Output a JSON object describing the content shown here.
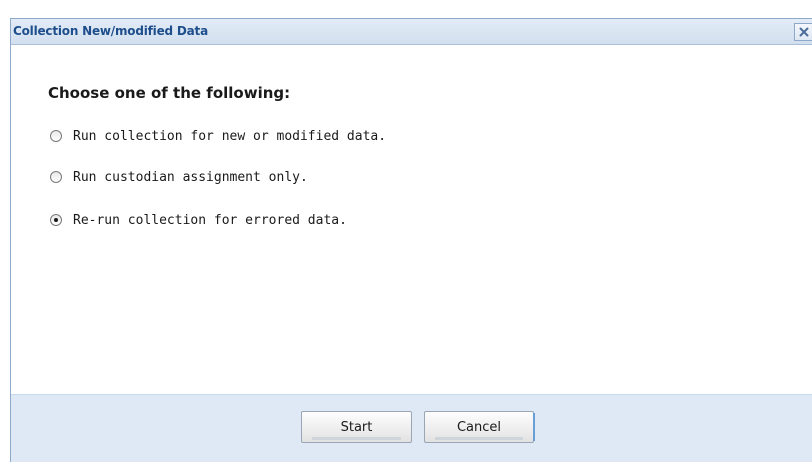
{
  "dialog": {
    "title": "Collection New/modified Data",
    "close_icon": "close-icon",
    "heading": "Choose one of the following:",
    "options": [
      {
        "label": "Run collection for new or modified data.",
        "selected": false
      },
      {
        "label": "Run custodian assignment only.",
        "selected": false
      },
      {
        "label": "Re-run collection for errored data.",
        "selected": true
      }
    ],
    "buttons": {
      "start": "Start",
      "cancel": "Cancel"
    }
  }
}
